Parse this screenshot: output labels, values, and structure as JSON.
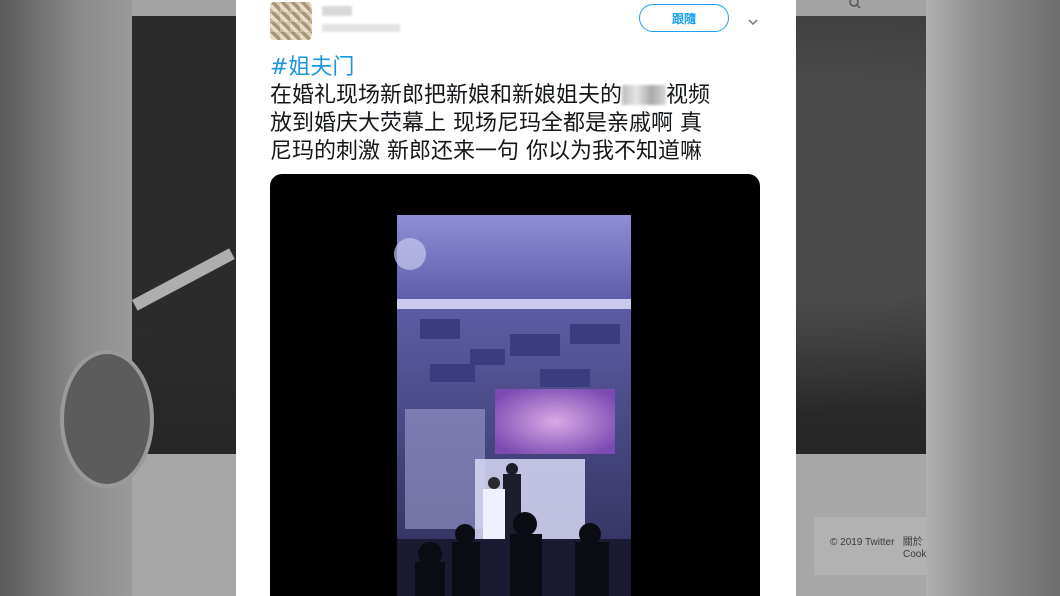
{
  "background": {
    "search_icon": "search-icon",
    "footer": {
      "copyright": "© 2019 Twitter",
      "about_link": "關於",
      "cookies_link": "Cook"
    }
  },
  "tweet": {
    "follow_label": "跟隨",
    "hashtag": "#姐夫门",
    "text_line1_a": "在婚礼现场新郎把新娘和新娘姐夫的",
    "text_line1_b": "视频",
    "text_line2": "放到婚庆大荧幕上   现场尼玛全都是亲戚啊 真",
    "text_line3": "尼玛的刺激   新郎还来一句  你以为我不知道嘛",
    "more_icon": "chevron-down-icon"
  },
  "colors": {
    "accent": "#1da1f2",
    "hashtag": "#1b95e0",
    "text": "#14171a"
  }
}
